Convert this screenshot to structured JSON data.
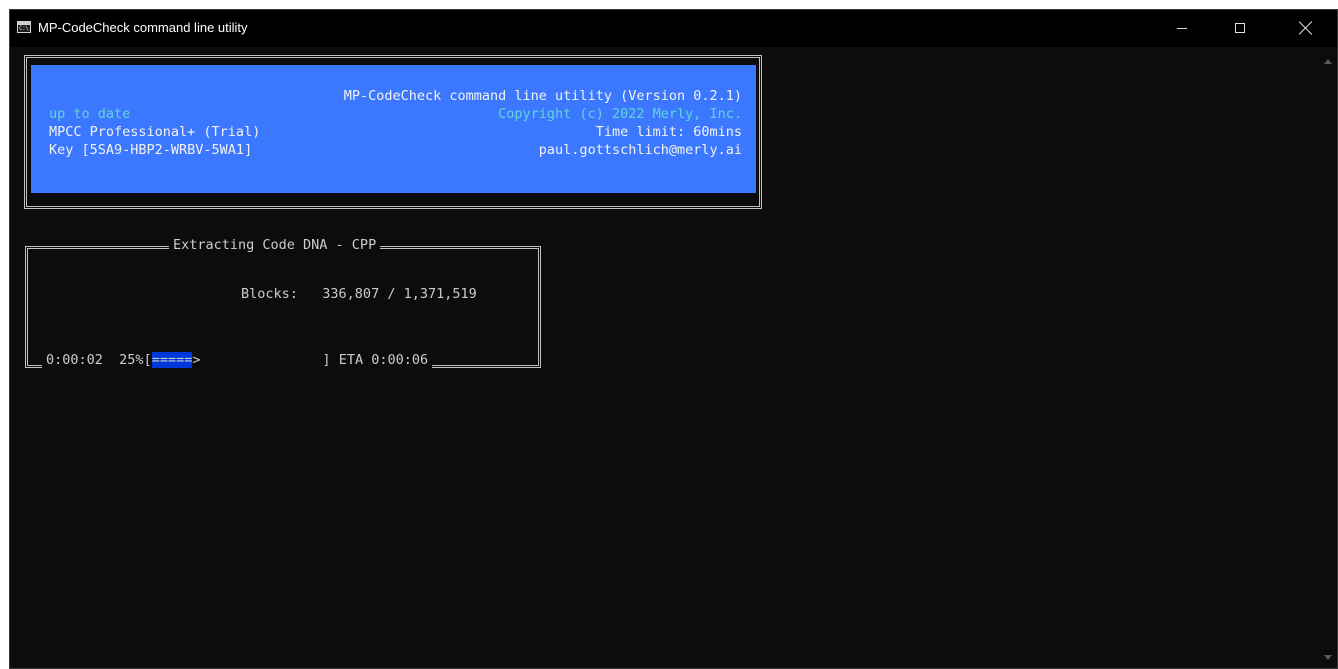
{
  "window": {
    "title": "MP-CodeCheck command line utility",
    "icon_text": "C:\\."
  },
  "header": {
    "product_line": "MP-CodeCheck command line utility (Version 0.2.1)",
    "status": "up to date",
    "copyright": "Copyright (c) 2022 Merly, Inc.",
    "edition": "MPCC Professional+ (Trial)",
    "time_limit": "Time limit: 60mins",
    "key": "Key [5SA9-HBP2-WRBV-5WA1]",
    "email": "paul.gottschlich@merly.ai"
  },
  "progress": {
    "title": "Extracting Code DNA - CPP",
    "blocks_label": "Blocks:",
    "blocks_value": "336,807 / 1,371,519",
    "elapsed": "0:00:02",
    "percent": "25%",
    "bar_open": "[",
    "bar_filled": "=====",
    "bar_head": ">",
    "bar_close": "]",
    "eta": "ETA 0:00:06"
  },
  "colors": {
    "console_bg": "#0c0c0c",
    "header_bg": "#3b78ff",
    "cyan_text": "#61d6d6",
    "bar_fill": "#0037da"
  }
}
